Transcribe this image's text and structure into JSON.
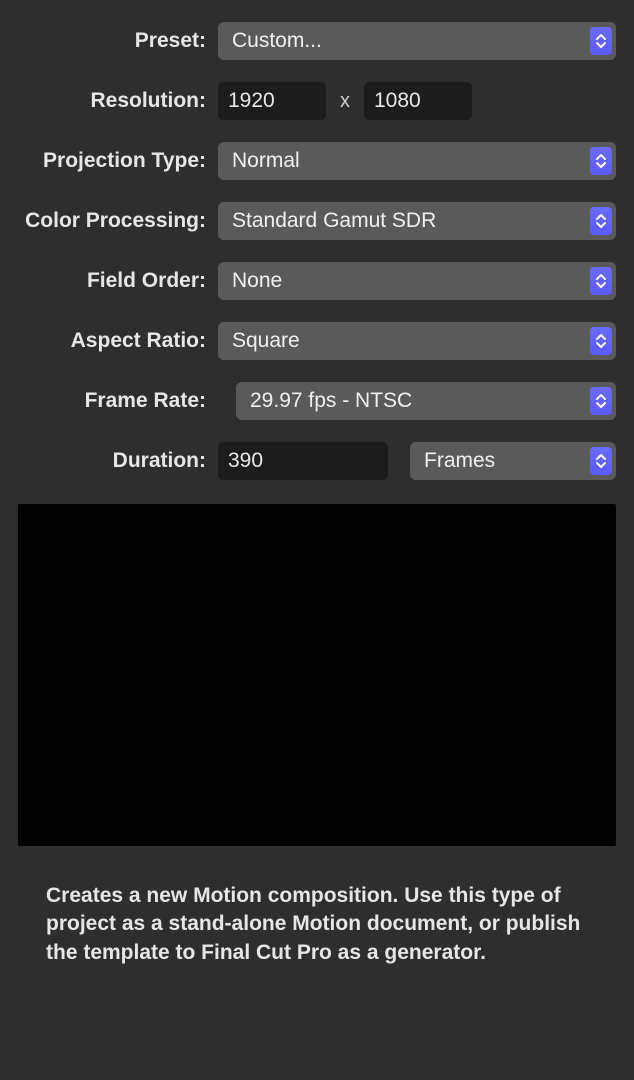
{
  "labels": {
    "preset": "Preset:",
    "resolution": "Resolution:",
    "projection": "Projection Type:",
    "color": "Color Processing:",
    "field": "Field Order:",
    "aspect": "Aspect Ratio:",
    "framerate": "Frame Rate:",
    "duration": "Duration:"
  },
  "values": {
    "preset": "Custom...",
    "res_w": "1920",
    "res_sep": "x",
    "res_h": "1080",
    "projection": "Normal",
    "color": "Standard Gamut SDR",
    "field": "None",
    "aspect": "Square",
    "framerate": "29.97 fps - NTSC",
    "duration": "390",
    "duration_unit": "Frames"
  },
  "description": "Creates a new Motion composition. Use this type of project as a stand-alone Motion document, or publish the template to Final Cut Pro as a generator."
}
